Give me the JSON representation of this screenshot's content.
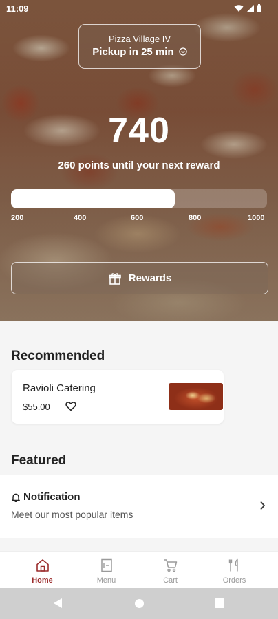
{
  "status_bar": {
    "time": "11:09"
  },
  "store": {
    "name": "Pizza Village IV",
    "pickup": "Pickup in 25 min"
  },
  "rewards": {
    "points": "740",
    "subtitle": "260 points until your next reward",
    "progress_fraction": 0.64,
    "ticks": [
      "200",
      "400",
      "600",
      "800",
      "1000"
    ],
    "button_label": "Rewards"
  },
  "recommended": {
    "title": "Recommended",
    "items": [
      {
        "name": "Ravioli Catering",
        "price": "$55.00"
      }
    ]
  },
  "featured": {
    "title": "Featured",
    "items": [
      {
        "title": "Notification",
        "subtitle": "Meet our most popular items"
      }
    ]
  },
  "bottom_nav": {
    "items": [
      {
        "label": "Home",
        "icon": "home-icon",
        "active": true
      },
      {
        "label": "Menu",
        "icon": "menu-icon",
        "active": false
      },
      {
        "label": "Cart",
        "icon": "cart-icon",
        "active": false
      },
      {
        "label": "Orders",
        "icon": "orders-icon",
        "active": false
      }
    ]
  },
  "colors": {
    "accent": "#9b2c2c",
    "inactive_nav": "#9a9a9a",
    "background": "#f5f5f5"
  }
}
